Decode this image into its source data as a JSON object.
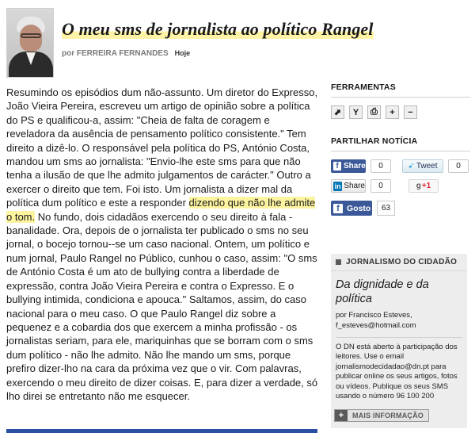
{
  "article": {
    "title": "O meu sms de jornalista ao político Rangel",
    "byline": "por FERREIRA FERNANDES",
    "date": "Hoje",
    "body_before": "Resumindo os episódios dum não-assunto. Um diretor do Expresso, João Vieira Pereira, escreveu um artigo de opinião sobre a política do PS e qualificou-a, assim: \"Cheia de falta de coragem e reveladora da ausência de pensamento político consistente.\" Tem direito a dizê-lo. O responsável pela política do PS, António Costa, mandou um sms ao jornalista: \"Envio-lhe este sms para que não tenha a ilusão de que lhe admito julgamentos de carácter.\" Outro a exercer o direito que tem. Foi isto. Um jornalista a dizer mal da política dum político e este a responder ",
    "body_highlight": "dizendo que não lhe admite o tom.",
    "body_after": " No fundo, dois cidadãos exercendo o seu direito à fala - banalidade. Ora, depois de o jornalista ter publicado o sms no seu jornal, o bocejo tornou--se um caso nacional. Ontem, um político e num jornal, Paulo Rangel no Público, cunhou o caso, assim: \"O sms de António Costa é um ato de bullying contra a liberdade de expressão, contra João Vieira Pereira e contra o Expresso. E o bullying intimida, condiciona e apouca.\" Saltamos, assim, do caso nacional para o meu caso. O que Paulo Rangel diz sobre a pequenez e a cobardia dos que exercem a minha profissão - os jornalistas seriam, para ele, mariquinhas que se borram com o sms dum político - não lhe admito. Não lhe mando um sms, porque prefiro dizer-lho na cara da próxima vez que o vir. Com palavras, exercendo o meu direito de dizer coisas. E, para dizer a verdade, só lho direi se entretanto não me esquecer."
  },
  "sidebar": {
    "tools_title": "FERRAMENTAS",
    "tools": [
      {
        "icon": "expand-icon",
        "glyph": "⬈"
      },
      {
        "icon": "share-tree-icon",
        "glyph": "Y"
      },
      {
        "icon": "print-icon",
        "glyph": "⎙"
      },
      {
        "icon": "font-increase-icon",
        "glyph": "+"
      },
      {
        "icon": "font-decrease-icon",
        "glyph": "−"
      }
    ],
    "share_title": "PARTILHAR NOTÍCIA",
    "facebook_share": {
      "label": "Share",
      "count": "0"
    },
    "twitter": {
      "label": "Tweet",
      "count": "0"
    },
    "linkedin": {
      "label": "Share",
      "count": "0"
    },
    "gplus": {
      "label": "+1"
    },
    "facebook_like": {
      "label": "Gosto",
      "count": "63"
    }
  },
  "citizen_box": {
    "header": "JORNALISMO DO CIDADÃO",
    "featured_title": "Da dignidade e da política",
    "author_line": "por Francisco Esteves,",
    "author_email": "f_esteves@hotmail.com",
    "info_text": "O DN está aberto à participação dos leitores. Use o email jornalismodecidadao@dn.pt para publicar online os seus artigos, fotos ou vídeos. Publique os seus SMS usando o número 96 100 200",
    "more_label": "MAIS INFORMAÇÃO"
  },
  "colors": {
    "highlight": "#fdf4a0",
    "facebook": "#3b5998",
    "accent_bar": "#2b4fa2"
  }
}
